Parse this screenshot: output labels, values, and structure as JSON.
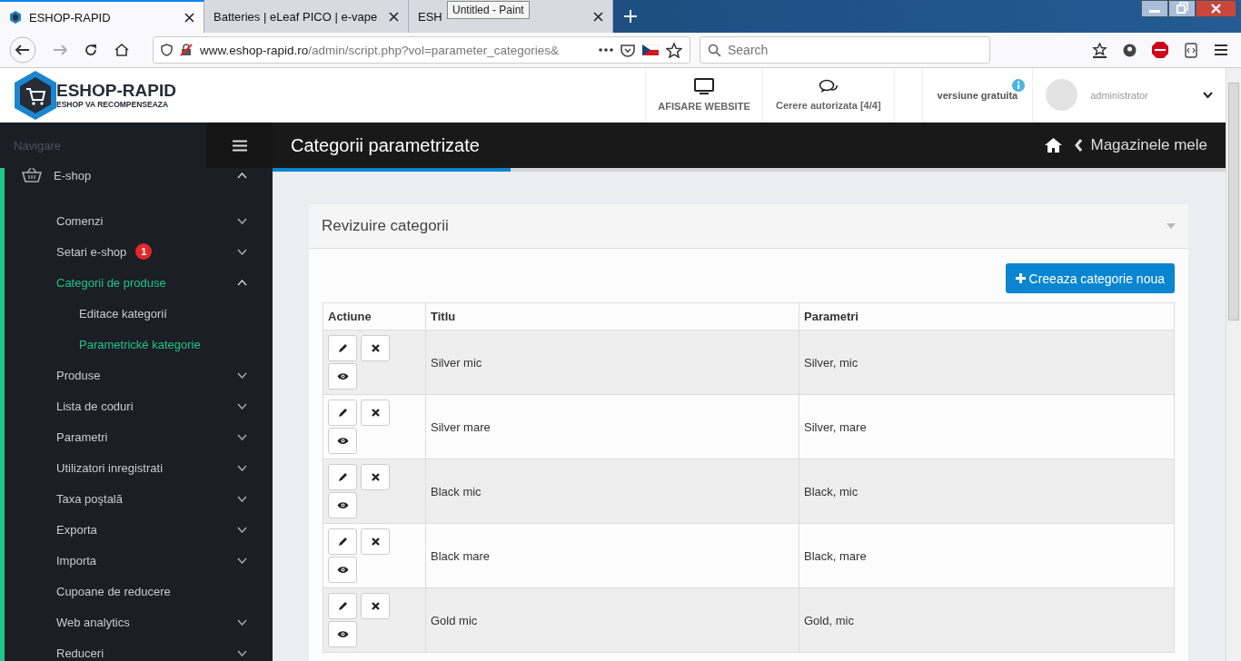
{
  "browser": {
    "tabs": [
      {
        "title": "ESHOP-RAPID",
        "selected": true
      },
      {
        "title": "Batteries | eLeaf PICO | e-vape",
        "selected": false
      },
      {
        "title": "ESH",
        "selected": false
      }
    ],
    "tooltip": "Untitled - Paint",
    "url_host": "www.eshop-rapid.ro",
    "url_path": "/admin/script.php?vol=parameter_categories&",
    "search": {
      "placeholder": "Search"
    }
  },
  "header": {
    "logo_title": "ESHOP-RAPID",
    "logo_subtitle": "ESHOP VA RECOMPENSEAZA",
    "actions": [
      {
        "label": "AFISARE WEBSITE",
        "kind": "monitor"
      },
      {
        "label": "Cerere autorizata [4/4]",
        "kind": "chat"
      }
    ],
    "version": "versiune gratuita",
    "user": "administrator"
  },
  "sidebar": {
    "heading": "Navigare",
    "items": [
      {
        "label": "E-shop",
        "kind": "submenu",
        "expanded": true,
        "selected": false,
        "children": [
          {
            "label": "Comenzi",
            "kind": "submenu",
            "expanded": false,
            "selected": false
          },
          {
            "label": "Setari e-shop",
            "badge": "1",
            "kind": "submenu",
            "expanded": false,
            "selected": false
          },
          {
            "label": "Categorii de produse",
            "kind": "submenu",
            "expanded": true,
            "selected": true,
            "children": [
              {
                "label": "Editace kategorií",
                "selected": false
              },
              {
                "label": "Parametrické kategorie",
                "selected": true
              }
            ]
          },
          {
            "label": "Produse",
            "kind": "submenu",
            "expanded": false,
            "selected": false
          },
          {
            "label": "Lista de coduri",
            "kind": "submenu",
            "expanded": false,
            "selected": false
          },
          {
            "label": "Parametri",
            "kind": "submenu",
            "expanded": false,
            "selected": false
          },
          {
            "label": "Utilizatori inregistrati",
            "kind": "submenu",
            "expanded": false,
            "selected": false
          },
          {
            "label": "Taxa poştală",
            "kind": "submenu",
            "expanded": false,
            "selected": false
          },
          {
            "label": "Exporta",
            "kind": "submenu",
            "expanded": false,
            "selected": false
          },
          {
            "label": "Importa",
            "kind": "submenu",
            "expanded": false,
            "selected": false
          },
          {
            "label": "Cupoane de reducere",
            "kind": "link",
            "selected": false
          },
          {
            "label": "Web analytics",
            "kind": "submenu",
            "expanded": false,
            "selected": false
          },
          {
            "label": "Reduceri",
            "kind": "submenu",
            "expanded": false,
            "selected": false
          }
        ]
      }
    ]
  },
  "page": {
    "title": "Categorii parametrizate",
    "breadcrumb": "Magazinele mele",
    "card": {
      "title": "Revizuire categorii",
      "button": "Creeaza categorie noua",
      "table": {
        "columns": [
          "Actiune",
          "Titlu",
          "Parametri"
        ],
        "rows": [
          {
            "title": "Silver mic",
            "params": "Silver, mic"
          },
          {
            "title": "Silver mare",
            "params": "Silver, mare"
          },
          {
            "title": "Black mic",
            "params": "Black, mic"
          },
          {
            "title": "Black mare",
            "params": "Black, mare"
          },
          {
            "title": "Gold mic",
            "params": "Gold, mic"
          }
        ]
      }
    }
  }
}
